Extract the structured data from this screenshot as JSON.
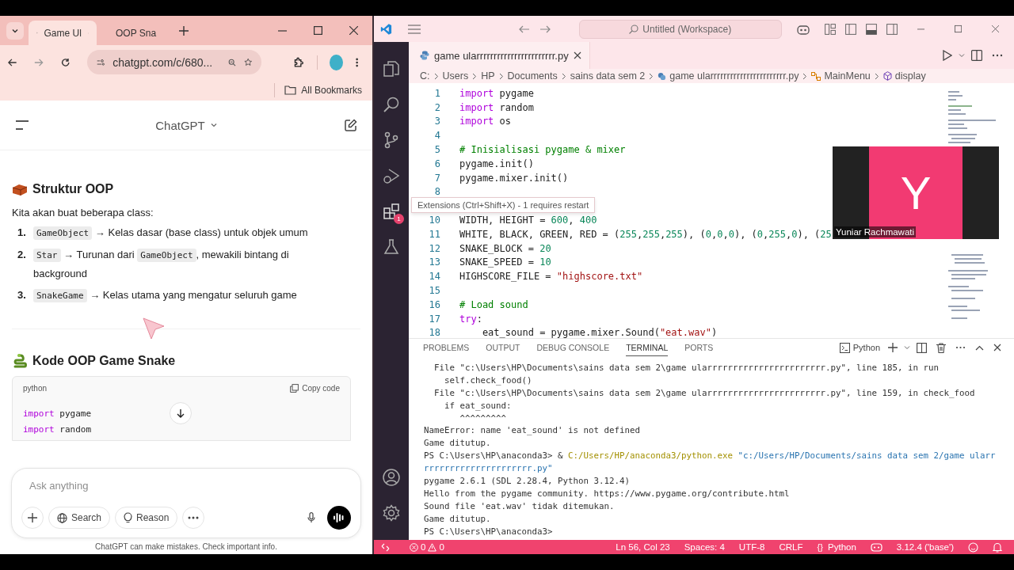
{
  "browser": {
    "tabs": [
      {
        "title": "Game Ul",
        "selected": true
      },
      {
        "title": "OOP Sna",
        "selected": false
      }
    ],
    "url": "chatgpt.com/c/680...",
    "bookmarks_folder": "All Bookmarks"
  },
  "chat": {
    "title": "ChatGPT",
    "section_1": {
      "heading": "Struktur OOP",
      "intro": "Kita akan buat beberapa class:",
      "items": [
        {
          "number": "1.",
          "segments": [
            {
              "kind": "code",
              "text": "GameObject"
            },
            {
              "kind": "text",
              "text": " → Kelas dasar (base class) untuk objek umum"
            }
          ]
        },
        {
          "number": "2.",
          "segments": [
            {
              "kind": "code",
              "text": "Star"
            },
            {
              "kind": "text",
              "text": " → Turunan dari "
            },
            {
              "kind": "code",
              "text": "GameObject"
            },
            {
              "kind": "text",
              "text": ", mewakili bintang di background"
            }
          ]
        },
        {
          "number": "3.",
          "segments": [
            {
              "kind": "code",
              "text": "SnakeGame"
            },
            {
              "kind": "text",
              "text": " → Kelas utama yang mengatur seluruh game"
            }
          ]
        }
      ]
    },
    "section_2": {
      "heading": "Kode OOP Game Snake",
      "code_block": {
        "language": "python",
        "copy_label": "Copy code",
        "lines": [
          [
            {
              "kind": "kw",
              "text": "import"
            },
            {
              "kind": "plain",
              "text": " pygame"
            }
          ],
          [
            {
              "kind": "kw",
              "text": "import"
            },
            {
              "kind": "plain",
              "text": " random"
            }
          ]
        ]
      }
    },
    "composer": {
      "placeholder": "Ask anything",
      "buttons": [
        "Search",
        "Reason"
      ]
    },
    "disclaimer": "ChatGPT can make mistakes. Check important info."
  },
  "vscode": {
    "command_center": "Untitled (Workspace)",
    "activity_bar": [
      {
        "kind": "explorer"
      },
      {
        "kind": "search"
      },
      {
        "kind": "source-control"
      },
      {
        "kind": "run"
      },
      {
        "kind": "extensions",
        "badge": "1"
      },
      {
        "kind": "testing"
      }
    ],
    "activity_bar_bottom": [
      {
        "kind": "account"
      },
      {
        "kind": "settings"
      }
    ],
    "editor_tab": "game ularrrrrrrrrrrrrrrrrrrrrrr.py",
    "breadcrumbs": [
      {
        "kind": "folder",
        "text": "C:"
      },
      {
        "kind": "folder",
        "text": "Users"
      },
      {
        "kind": "folder",
        "text": "HP"
      },
      {
        "kind": "folder",
        "text": "Documents"
      },
      {
        "kind": "folder",
        "text": "sains data sem 2"
      },
      {
        "kind": "file",
        "text": "game ularrrrrrrrrrrrrrrrrrrrrrr.py"
      },
      {
        "kind": "class",
        "text": "MainMenu"
      },
      {
        "kind": "method",
        "text": "display"
      }
    ],
    "lines_above": [
      {
        "number": "1",
        "tokens": [
          {
            "kind": "kw",
            "text": "import"
          },
          {
            "kind": "plain",
            "text": " pygame"
          }
        ]
      },
      {
        "number": "2",
        "tokens": [
          {
            "kind": "kw",
            "text": "import"
          },
          {
            "kind": "plain",
            "text": " random"
          }
        ]
      },
      {
        "number": "3",
        "tokens": [
          {
            "kind": "kw",
            "text": "import"
          },
          {
            "kind": "plain",
            "text": " os"
          }
        ]
      },
      {
        "number": "4"
      },
      {
        "number": "5",
        "tokens": [
          {
            "kind": "comment",
            "text": "# Inisialisasi pygame & mixer"
          }
        ]
      },
      {
        "number": "6",
        "tokens": [
          {
            "kind": "plain",
            "text": "pygame.init()"
          }
        ]
      },
      {
        "number": "7",
        "tokens": [
          {
            "kind": "plain",
            "text": "pygame.mixer.init()"
          }
        ]
      },
      {
        "number": "8"
      }
    ],
    "tooltip": "Extensions (Ctrl+Shift+X) - 1 requires restart",
    "lines_below": [
      {
        "number": "10",
        "tokens": [
          {
            "kind": "plain",
            "text": "WIDTH, HEIGHT = "
          },
          {
            "kind": "num",
            "text": "600"
          },
          {
            "kind": "plain",
            "text": ", "
          },
          {
            "kind": "num",
            "text": "400"
          }
        ]
      },
      {
        "number": "11",
        "tokens": [
          {
            "kind": "plain",
            "text": "WHITE, BLACK, GREEN, RED = ("
          },
          {
            "kind": "num",
            "text": "255"
          },
          {
            "kind": "plain",
            "text": ","
          },
          {
            "kind": "num",
            "text": "255"
          },
          {
            "kind": "plain",
            "text": ","
          },
          {
            "kind": "num",
            "text": "255"
          },
          {
            "kind": "plain",
            "text": "), ("
          },
          {
            "kind": "num",
            "text": "0"
          },
          {
            "kind": "plain",
            "text": ","
          },
          {
            "kind": "num",
            "text": "0"
          },
          {
            "kind": "plain",
            "text": ","
          },
          {
            "kind": "num",
            "text": "0"
          },
          {
            "kind": "plain",
            "text": "), ("
          },
          {
            "kind": "num",
            "text": "0"
          },
          {
            "kind": "plain",
            "text": ","
          },
          {
            "kind": "num",
            "text": "255"
          },
          {
            "kind": "plain",
            "text": ","
          },
          {
            "kind": "num",
            "text": "0"
          },
          {
            "kind": "plain",
            "text": "), ("
          },
          {
            "kind": "num",
            "text": "25"
          }
        ]
      },
      {
        "number": "12",
        "tokens": [
          {
            "kind": "plain",
            "text": "SNAKE_BLOCK = "
          },
          {
            "kind": "num",
            "text": "20"
          }
        ]
      },
      {
        "number": "13",
        "tokens": [
          {
            "kind": "plain",
            "text": "SNAKE_SPEED = "
          },
          {
            "kind": "num",
            "text": "10"
          }
        ]
      },
      {
        "number": "14",
        "tokens": [
          {
            "kind": "plain",
            "text": "HIGHSCORE_FILE = "
          },
          {
            "kind": "str",
            "text": "\"highscore.txt\""
          }
        ]
      },
      {
        "number": "15"
      },
      {
        "number": "16",
        "tokens": [
          {
            "kind": "comment",
            "text": "# Load sound"
          }
        ]
      },
      {
        "number": "17",
        "tokens": [
          {
            "kind": "kw",
            "text": "try"
          },
          {
            "kind": "plain",
            "text": ":"
          }
        ]
      },
      {
        "number": "18",
        "tokens": [
          {
            "kind": "plain",
            "text": "    eat_sound = pygame.mixer.Sound("
          },
          {
            "kind": "str",
            "text": "\"eat.wav\""
          },
          {
            "kind": "plain",
            "text": ")"
          }
        ]
      }
    ],
    "video_tile": {
      "initial": "Y",
      "name": "Yuniar Rachmawati"
    },
    "panel_tabs": [
      {
        "label": "PROBLEMS",
        "selected": false
      },
      {
        "label": "OUTPUT",
        "selected": false
      },
      {
        "label": "DEBUG CONSOLE",
        "selected": false
      },
      {
        "label": "TERMINAL",
        "selected": true
      },
      {
        "label": "PORTS",
        "selected": false
      }
    ],
    "terminal_name": "Python",
    "terminal": [
      [
        {
          "kind": "plain",
          "text": "  File \"c:\\Users\\HP\\Documents\\sains data sem 2\\game ularrrrrrrrrrrrrrrrrrrrrrr.py\", line 185, in run"
        }
      ],
      [
        {
          "kind": "plain",
          "text": "    self.check_food()"
        }
      ],
      [
        {
          "kind": "plain",
          "text": "  File \"c:\\Users\\HP\\Documents\\sains data sem 2\\game ularrrrrrrrrrrrrrrrrrrrrrr.py\", line 159, in check_food"
        }
      ],
      [
        {
          "kind": "plain",
          "text": "    if eat_sound:"
        }
      ],
      [
        {
          "kind": "plain",
          "text": "       ^^^^^^^^^"
        }
      ],
      [
        {
          "kind": "plain",
          "text": "NameError: name 'eat_sound' is not defined"
        }
      ],
      [
        {
          "kind": "plain",
          "text": "Game ditutup."
        }
      ],
      [
        {
          "kind": "plain",
          "text": "PS C:\\Users\\HP\\anaconda3> & "
        },
        {
          "kind": "path",
          "text": "C:/Users/HP/anaconda3/python.exe"
        },
        {
          "kind": "str",
          "text": " \"c:/Users/HP/Documents/sains data sem 2/game ularr"
        }
      ],
      [
        {
          "kind": "str",
          "text": "rrrrrrrrrrrrrrrrrrrrr.py\""
        }
      ],
      [
        {
          "kind": "plain",
          "text": "pygame 2.6.1 (SDL 2.28.4, Python 3.12.4)"
        }
      ],
      [
        {
          "kind": "plain",
          "text": "Hello from the pygame community. https://www.pygame.org/contribute.html"
        }
      ],
      [
        {
          "kind": "plain",
          "text": "Sound file 'eat.wav' tidak ditemukan."
        }
      ],
      [
        {
          "kind": "plain",
          "text": "Game ditutup."
        }
      ],
      [
        {
          "kind": "plain",
          "text": "PS C:\\Users\\HP\\anaconda3>"
        }
      ]
    ],
    "status_bar": {
      "errors": "0",
      "warnings": "0",
      "right": [
        {
          "kind": "text",
          "text": "Ln 56, Col 23"
        },
        {
          "kind": "text",
          "text": "Spaces: 4"
        },
        {
          "kind": "text",
          "text": "UTF-8"
        },
        {
          "kind": "text",
          "text": "CRLF"
        },
        {
          "kind": "language",
          "icon": "{}",
          "text": "Python"
        },
        {
          "kind": "copilot"
        },
        {
          "kind": "text",
          "text": "3.12.4 ('base')"
        },
        {
          "kind": "feedback"
        },
        {
          "kind": "bell"
        }
      ]
    }
  }
}
